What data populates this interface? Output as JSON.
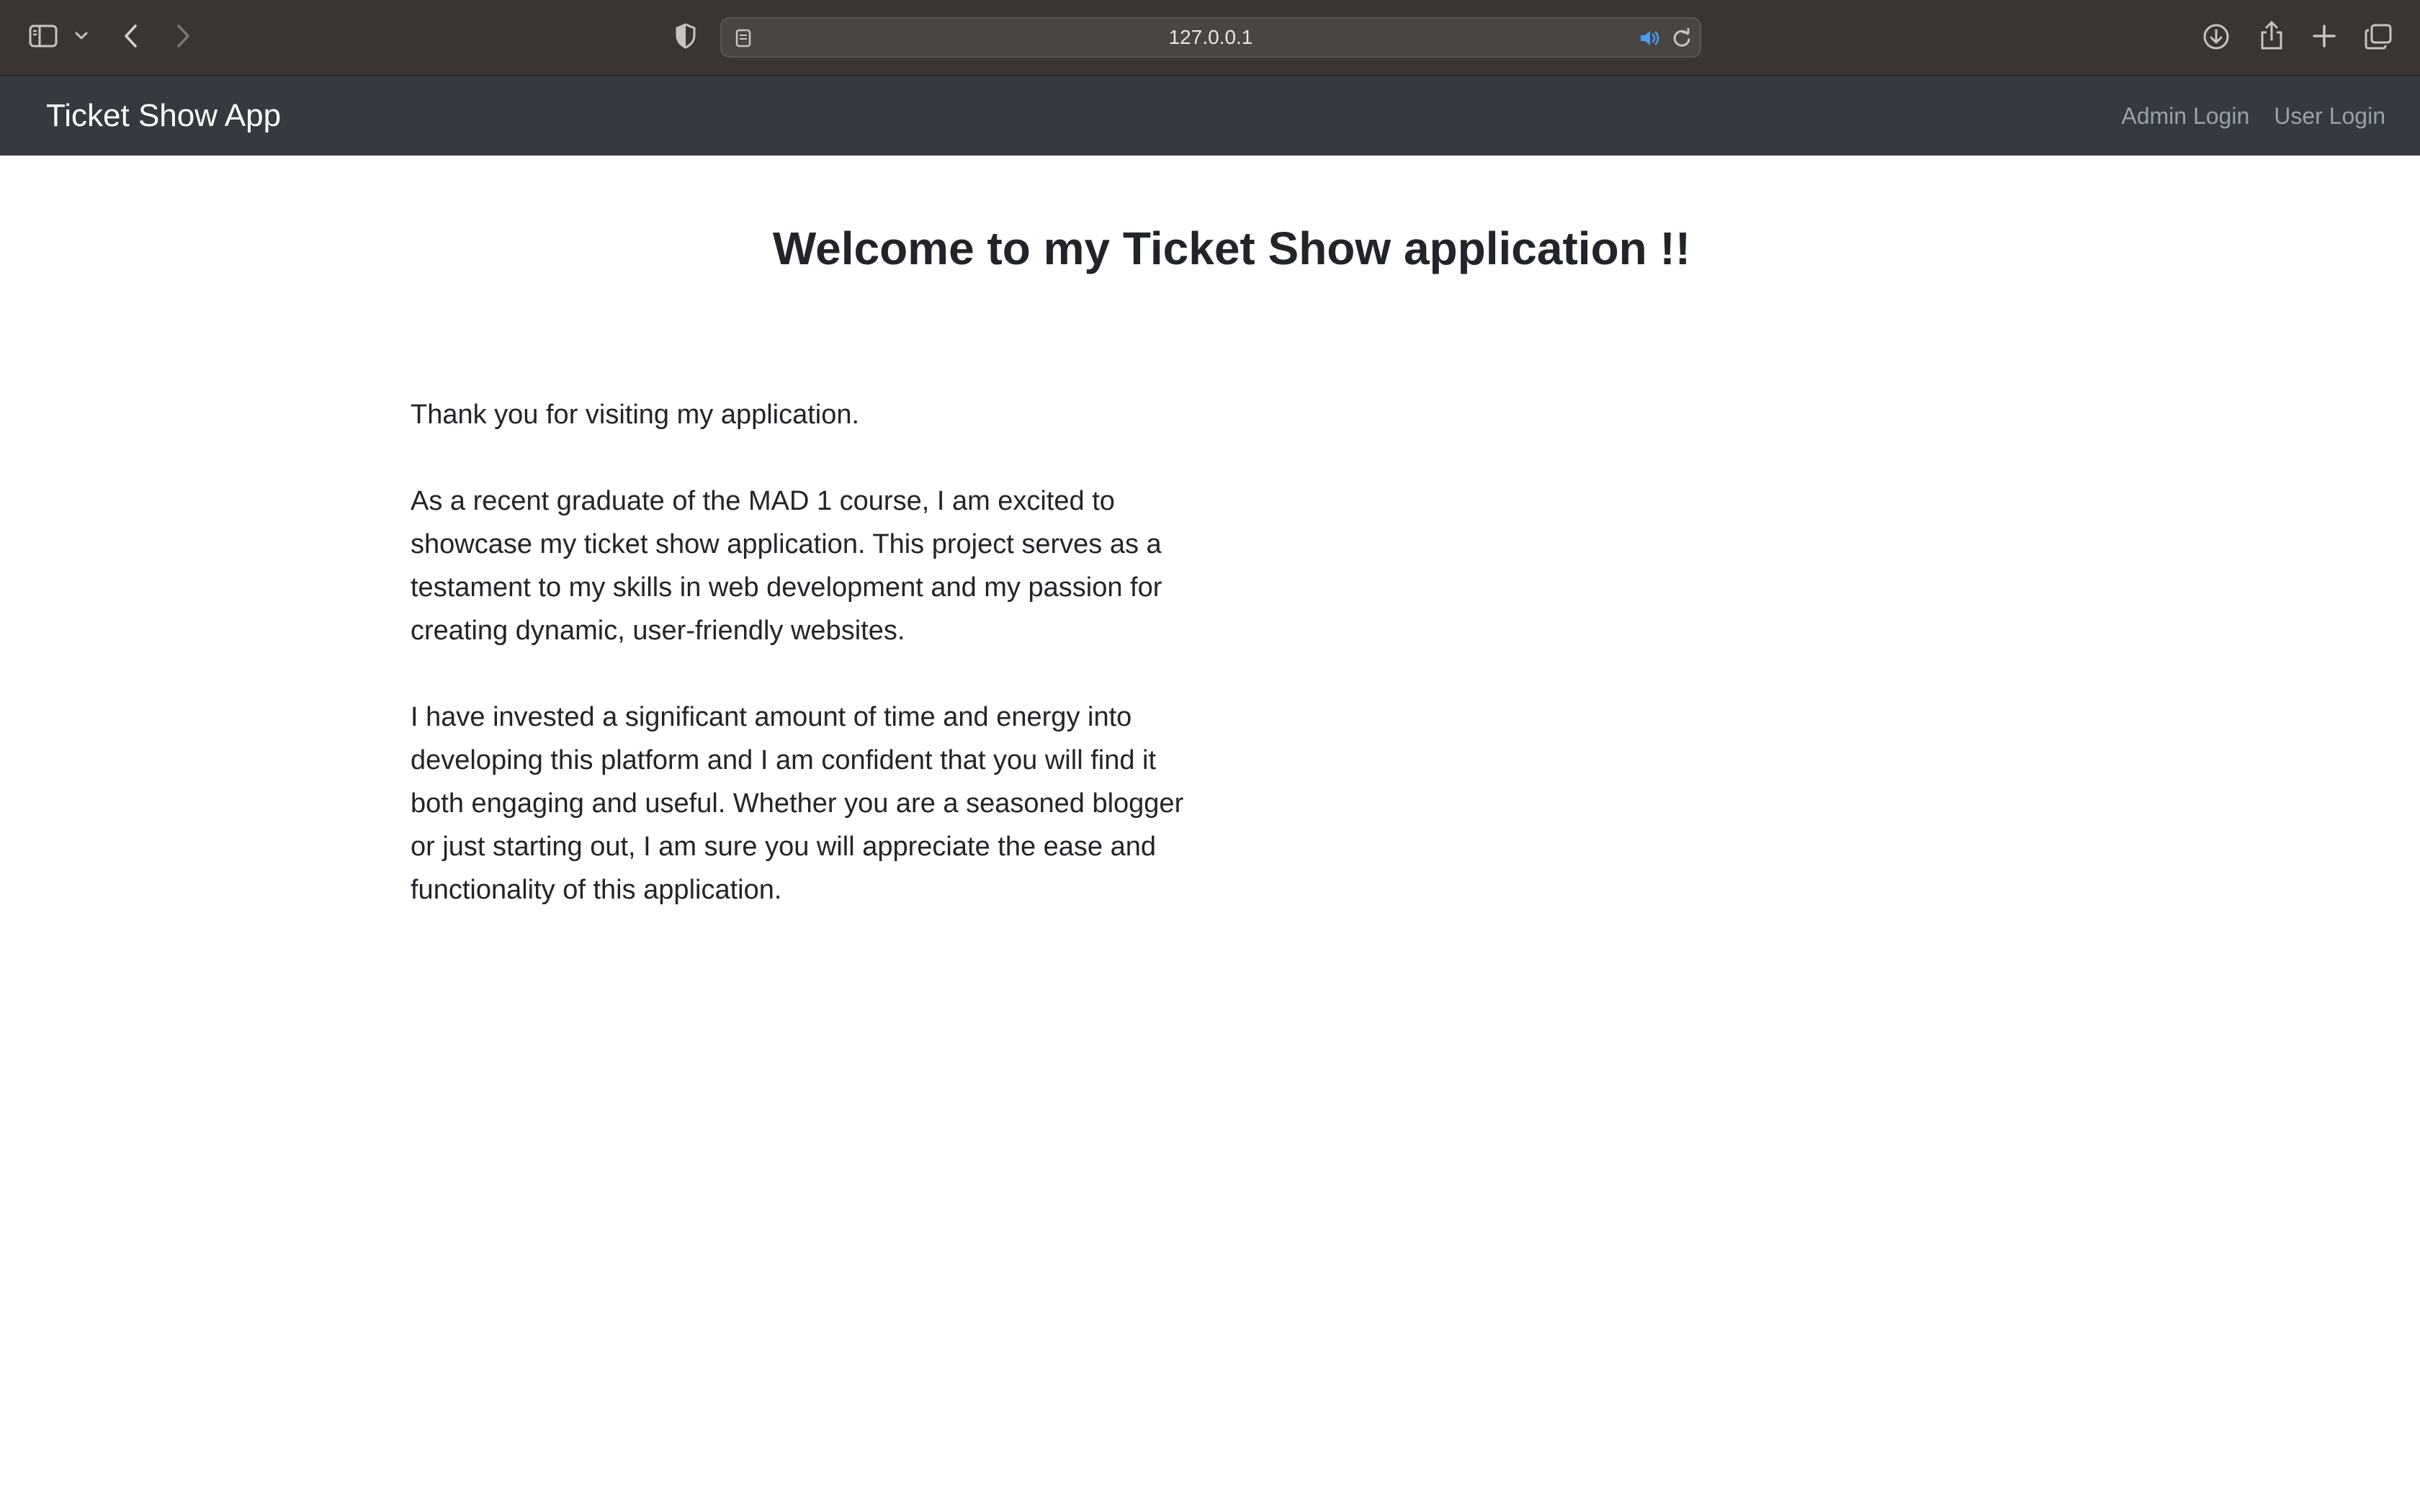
{
  "browser": {
    "url": "127.0.0.1"
  },
  "navbar": {
    "brand": "Ticket Show App",
    "links": [
      {
        "label": "Admin Login"
      },
      {
        "label": "User Login"
      }
    ]
  },
  "main": {
    "title": "Welcome to my Ticket Show application !!",
    "paragraphs": [
      "Thank you for visiting my application.",
      "As a recent graduate of the MAD 1 course, I am excited to showcase my ticket show application. This project serves as a testament to my skills in web development and my passion for creating dynamic, user-friendly websites.",
      "I have invested a significant amount of time and energy into developing this platform and I am confident that you will find it both engaging and useful. Whether you are a seasoned blogger or just starting out, I am sure you will appreciate the ease and functionality of this application."
    ]
  },
  "colors": {
    "browser_bar": "#3a3533",
    "navbar": "#343a40",
    "nav_link": "#9aa1a8",
    "text": "#212529",
    "audio_accent": "#4a9cf5"
  }
}
